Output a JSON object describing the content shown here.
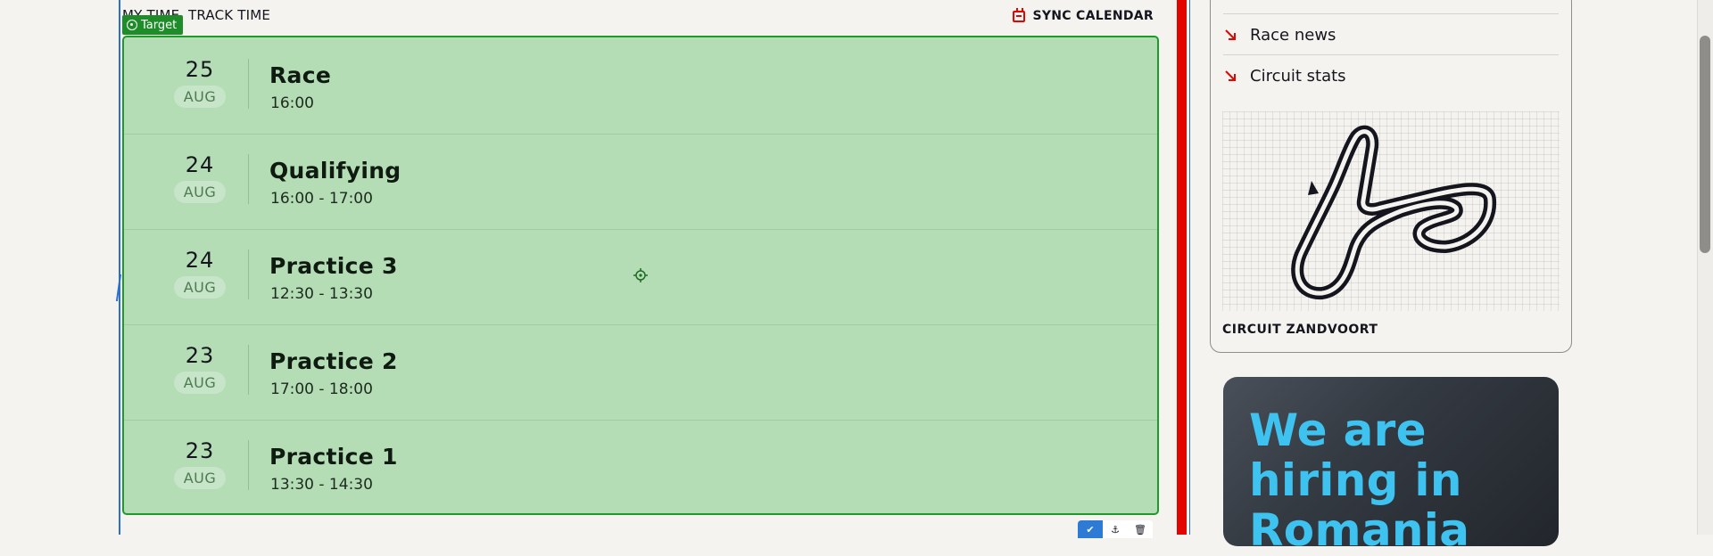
{
  "header": {
    "tabs": [
      "MY TIME",
      "TRACK TIME"
    ],
    "sync_label": "SYNC CALENDAR"
  },
  "badge": {
    "label": "Target"
  },
  "schedule": [
    {
      "day": "25",
      "month": "AUG",
      "session": "Race",
      "time": "16:00"
    },
    {
      "day": "24",
      "month": "AUG",
      "session": "Qualifying",
      "time": "16:00 - 17:00"
    },
    {
      "day": "24",
      "month": "AUG",
      "session": "Practice 3",
      "time": "12:30 - 13:30"
    },
    {
      "day": "23",
      "month": "AUG",
      "session": "Practice 2",
      "time": "17:00 - 18:00"
    },
    {
      "day": "23",
      "month": "AUG",
      "session": "Practice 1",
      "time": "13:30 - 14:30"
    }
  ],
  "side": {
    "links": [
      "Race news",
      "Circuit stats"
    ],
    "circuit_name": "CIRCUIT ZANDVOORT",
    "hiring": "We are hiring in Romania"
  },
  "colors": {
    "accent_red": "#e10600",
    "highlight_green": "#b4ddb6",
    "highlight_border": "#1f9a2a",
    "hiring_blue": "#3ec3f0"
  },
  "icons": [
    "calendar-icon",
    "target-icon",
    "crosshair-icon",
    "check-icon",
    "pin-icon",
    "trash-icon",
    "arrow-down-right-icon",
    "track-map"
  ]
}
